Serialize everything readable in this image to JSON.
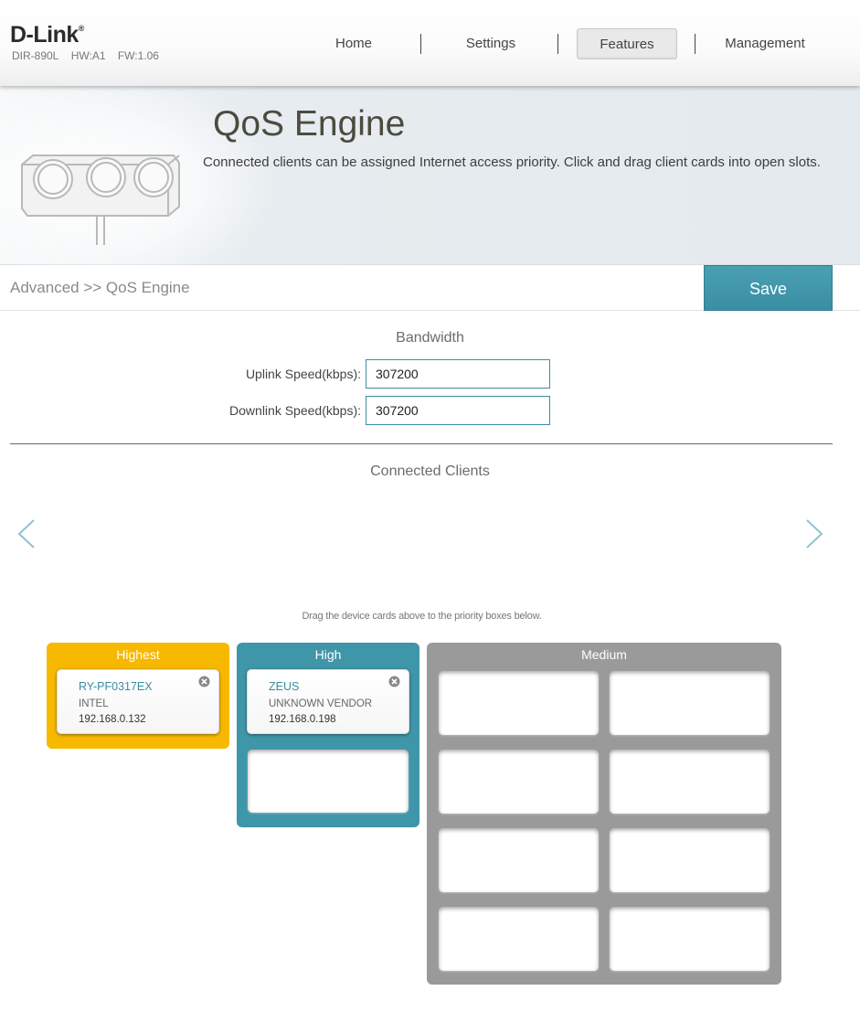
{
  "header": {
    "logo": "D-Link",
    "logo_mark": "®",
    "model": "DIR-890L",
    "hardware": "HW:A1",
    "firmware": "FW:1.06",
    "nav": {
      "home": "Home",
      "settings": "Settings",
      "features": "Features",
      "management": "Management"
    },
    "active_nav": "Features"
  },
  "banner": {
    "title": "QoS Engine",
    "description": "Connected clients can be assigned Internet access priority. Click and drag client cards into open slots.",
    "illustration_icon": "qos-gauge-illustration"
  },
  "breadcrumb": "Advanced >> QoS Engine",
  "save_label": "Save",
  "bandwidth": {
    "title": "Bandwidth",
    "uplink_label": "Uplink Speed(kbps):",
    "uplink_value": "307200",
    "downlink_label": "Downlink Speed(kbps):",
    "downlink_value": "307200"
  },
  "connected_clients": {
    "title": "Connected Clients",
    "prev_icon": "chevron-left-icon",
    "next_icon": "chevron-right-icon"
  },
  "drag_hint": "Drag the device cards above to the priority boxes below.",
  "priority": {
    "highest": {
      "title": "Highest",
      "color": "#f7b800",
      "clients": [
        {
          "name": "RY-PF0317EX",
          "vendor": "INTEL",
          "ip": "192.168.0.132"
        }
      ],
      "empty_slots": 0
    },
    "high": {
      "title": "High",
      "color": "#3f96a8",
      "clients": [
        {
          "name": "ZEUS",
          "vendor": "UNKNOWN VENDOR",
          "ip": "192.168.0.198"
        }
      ],
      "empty_slots": 1
    },
    "medium": {
      "title": "Medium",
      "color": "#9a9a9a",
      "clients": [],
      "empty_slots": 8
    }
  },
  "colors": {
    "accent": "#3a8ea2",
    "save_button": "#4aa0b3"
  }
}
